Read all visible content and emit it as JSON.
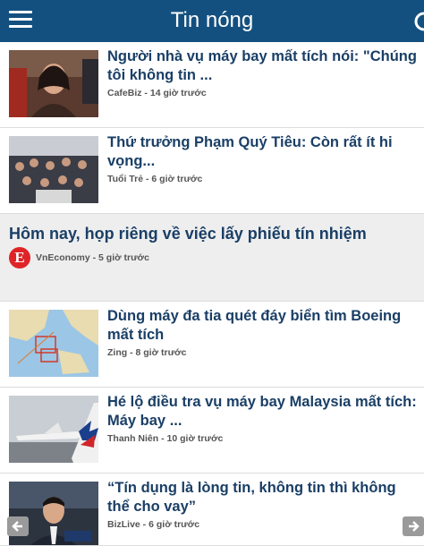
{
  "header": {
    "title": "Tin nóng"
  },
  "feed": {
    "items": [
      {
        "title": "Người nhà vụ máy bay mất tích nói: \"Chúng tôi không tin ...",
        "source": "CafeBiz",
        "time": "14 giờ trước"
      },
      {
        "title": "Thứ trưởng Phạm Quý Tiêu: Còn rất ít hi vọng...",
        "source": "Tuổi Trẻ",
        "time": "6 giờ trước"
      },
      {
        "title": "Hôm nay, họp riêng về việc lấy phiếu tín nhiệm",
        "source": "VnEconomy",
        "time": "5 giờ trước",
        "logo_letter": "E"
      },
      {
        "title": "Dùng máy đa tia quét đáy biển tìm Boeing mất tích",
        "source": "Zing",
        "time": "8 giờ trước"
      },
      {
        "title": "Hé lộ điều tra vụ máy bay Malaysia mất tích: Máy bay ...",
        "source": "Thanh Niên",
        "time": "10 giờ trước"
      },
      {
        "title": "“Tín dụng là lòng tin, không tin thì không thể cho vay”",
        "source": "BizLive",
        "time": "6 giờ trước"
      }
    ]
  },
  "icons": {
    "menu": "hamburger-icon",
    "refresh": "refresh-icon",
    "prev": "arrow-left-icon",
    "next": "arrow-right-icon"
  },
  "colors": {
    "header": "#14507f",
    "title": "#1a3f66",
    "logo": "#e02327"
  }
}
